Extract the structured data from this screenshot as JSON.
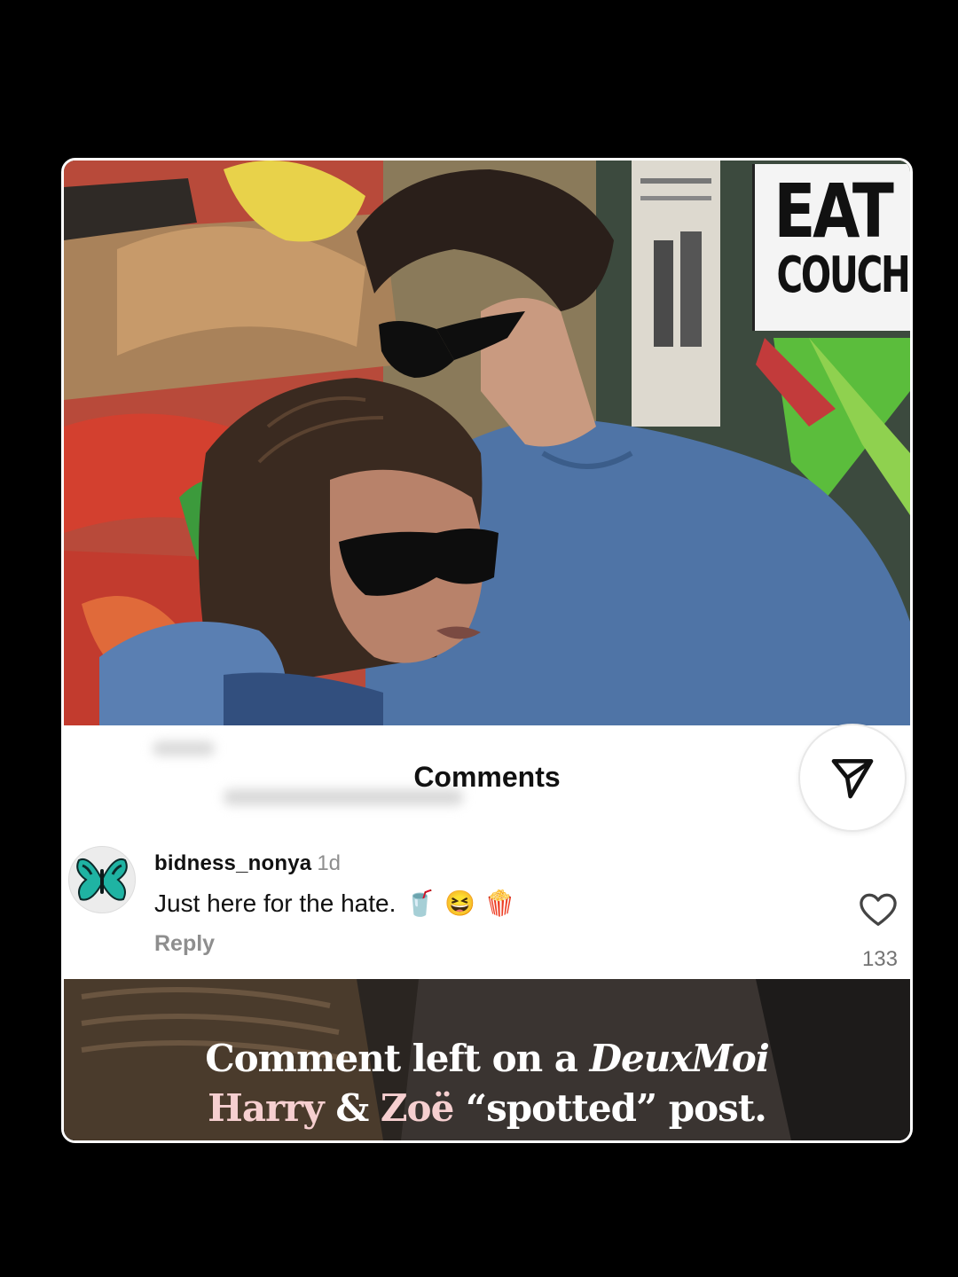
{
  "sign": {
    "line1": "EAT",
    "line2": "COUCH"
  },
  "comments_panel": {
    "title": "Comments",
    "comment": {
      "username": "bidness_nonya",
      "time": "1d",
      "text": "Just here for the hate.",
      "emojis": [
        "🥤",
        "😆",
        "🍿"
      ],
      "reply_label": "Reply",
      "like_count": "133"
    }
  },
  "caption": {
    "line1_a": "Comment left on a ",
    "line1_b": "DeuxMoi",
    "line2_a": "Harry",
    "line2_b": " & ",
    "line2_c": "Zoë",
    "line2_d": " “spotted” post."
  },
  "icons": {
    "share": "paper-plane-icon",
    "like": "heart-outline-icon",
    "avatar": "butterfly-icon"
  }
}
